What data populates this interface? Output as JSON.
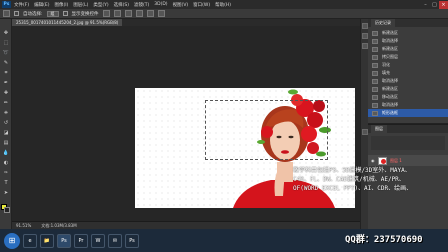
{
  "menubar": {
    "logo": "Ps",
    "items": [
      "文件(F)",
      "编辑(E)",
      "图像(I)",
      "图层(L)",
      "类型(Y)",
      "选择(S)",
      "滤镜(T)",
      "3D(D)",
      "视图(V)",
      "窗口(W)",
      "帮助(H)"
    ],
    "minimize": "–",
    "maximize": "□",
    "close": "×"
  },
  "options": {
    "mode_label": "自动选择:",
    "mode_value": "组",
    "show_transform": "显示变换控件"
  },
  "tab": {
    "title": "25315_0017401011445204_2.jpg @ 91.5%(RGB/8)"
  },
  "status": {
    "zoom": "91.51%",
    "docinfo": "文档:1.03M/3.83M"
  },
  "history": {
    "tab_label": "历史记录",
    "items": [
      {
        "label": "新建选区",
        "active": false
      },
      {
        "label": "取消选择",
        "active": false
      },
      {
        "label": "新建选区",
        "active": false
      },
      {
        "label": "拷贝图层",
        "active": false
      },
      {
        "label": "羽化",
        "active": false
      },
      {
        "label": "填充",
        "active": false
      },
      {
        "label": "取消选择",
        "active": false
      },
      {
        "label": "新建选区",
        "active": false
      },
      {
        "label": "移动选区",
        "active": false
      },
      {
        "label": "取消选择",
        "active": false
      },
      {
        "label": "矩形选框",
        "active": true
      }
    ]
  },
  "layers": {
    "tab_label": "图层",
    "rows": [
      {
        "label": "图层 1",
        "active": true
      }
    ]
  },
  "overlay": {
    "lines": [
      "教学科目包括PS、3D建模/3D室外、MAYA、",
      "C4D、FL、DW、CAD建筑/机械、AE/PR、",
      "OF(WORD EXCEL PPT)、AI、CDR、绘画、"
    ],
    "qq": "QQ群：237570690"
  },
  "taskbar": {
    "start": "⊞",
    "apps": [
      "e",
      "📁",
      "Ps",
      "Pr",
      "W",
      "✉",
      "Ps"
    ]
  }
}
